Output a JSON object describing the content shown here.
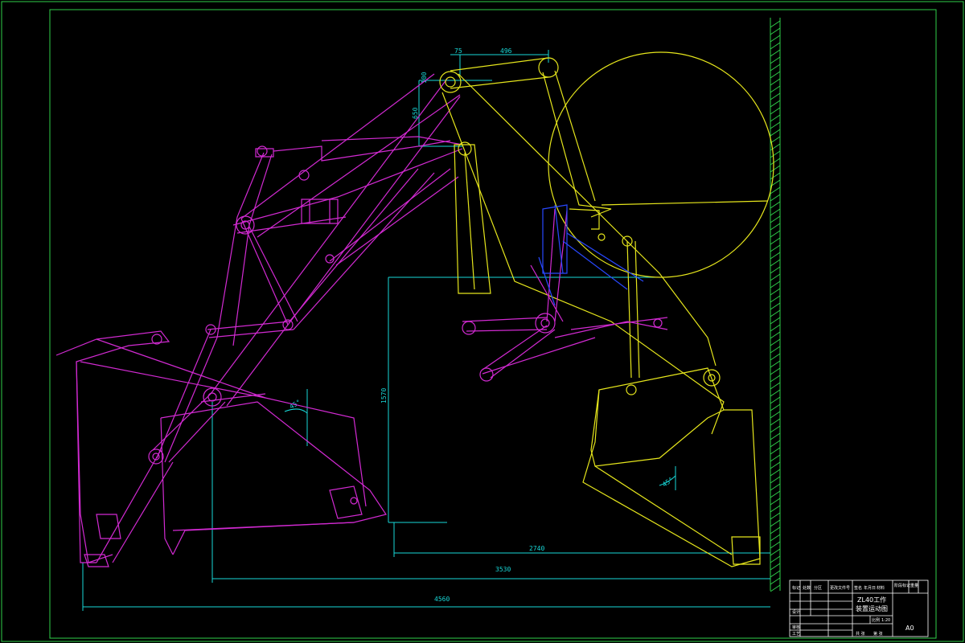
{
  "colors": {
    "background": "#000000",
    "border": "#2fd04a",
    "dimension": "#18d8d8",
    "mechanism_magenta": "#d22ad2",
    "mechanism_yellow": "#e6e61c",
    "mechanism_blue": "#2848ff",
    "hatch": "#2fd04a",
    "titleblock": "#ffffff"
  },
  "dimensions": {
    "d75": "75",
    "d496": "496",
    "d100": "100",
    "d650": "650",
    "d1570": "1570",
    "d2740": "2740",
    "d3530": "3530",
    "d4560": "4560",
    "angle_left": "45°",
    "angle_right": "45°"
  },
  "title_block": {
    "header_cols": [
      "标记",
      "处数",
      "分区",
      "更改文件号",
      "签名",
      "年月日"
    ],
    "material_label": "材料",
    "title_line1": "ZL40工作",
    "title_line2": "装置运动图",
    "drawing_no": "A0",
    "role_designer": "设计",
    "role_check": "审核",
    "role_process": "工艺",
    "stage_label": "阶段标记",
    "weight_label": "重量",
    "scale_label": "比例",
    "scale_value": "1:20",
    "sheet_label": "共 张",
    "sheet_label2": "第 张"
  }
}
